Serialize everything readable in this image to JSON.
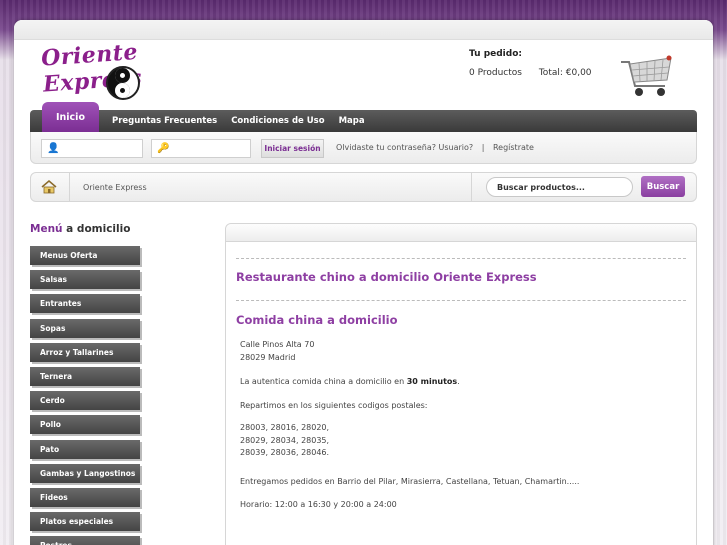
{
  "logo": {
    "text": "Oriente Express"
  },
  "cart": {
    "title": "Tu pedido:",
    "products": "0 Productos",
    "total": "Total: €0,00"
  },
  "nav": {
    "items": [
      "Inicio",
      "Preguntas Frecuentes",
      "Condiciones de Uso",
      "Mapa"
    ]
  },
  "login": {
    "button": "Iniciar sesión",
    "forgot": "Olvidaste tu contraseña? Usuario?",
    "sep": "|",
    "register": "Regístrate"
  },
  "breadcrumb": {
    "current": "Oriente Express"
  },
  "search": {
    "placeholder": "Buscar productos...",
    "button": "Buscar"
  },
  "sidebar": {
    "title_a": "Menú",
    "title_b": " a domicilio",
    "items": [
      "Menus Oferta",
      "Salsas",
      "Entrantes",
      "Sopas",
      "Arroz y Tallarines",
      "Ternera",
      "Cerdo",
      "Pollo",
      "Pato",
      "Gambas y Langostinos",
      "Fideos",
      "Platos especiales",
      "Postres"
    ]
  },
  "content": {
    "title1": "Restaurante chino a domicilio Oriente Express",
    "title2": "Comida china a domicilio",
    "address1": "Calle Pinos Alta 70",
    "address2": "28029 Madrid",
    "line_auth_pre": "La autentica comida china a domicilio en ",
    "line_auth_bold": "30 minutos",
    "line_auth_post": ".",
    "postal_intro": "Repartimos en los siguientes codigos postales:",
    "postal1": "28003, 28016, 28020,",
    "postal2": "28029, 28034, 28035,",
    "postal3": "28039, 28036, 28046.",
    "areas": "Entregamos pedidos en Barrio del Pilar, Mirasierra, Castellana, Tetuan, Chamartin.....",
    "hours": "Horario: 12:00 a 16:30 y 20:00 a 24:00"
  },
  "colors": {
    "accent": "#8e3fa3",
    "nav_dark": "#444444"
  }
}
